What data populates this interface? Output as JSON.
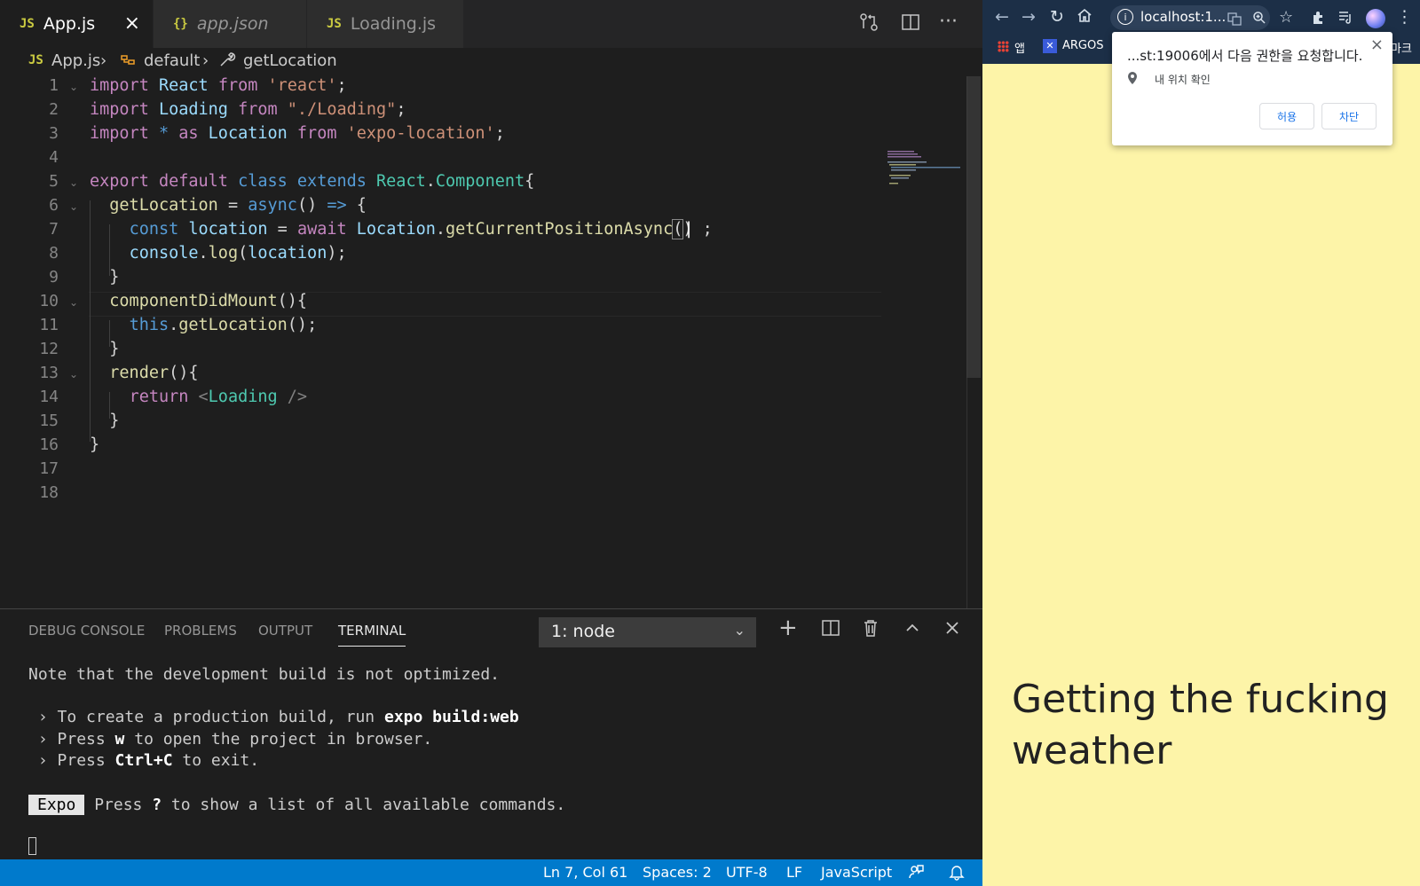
{
  "editor": {
    "tabs": [
      {
        "icon": "JS",
        "label": "App.js",
        "active": true,
        "close": "×"
      },
      {
        "icon": "{}",
        "label": "app.json",
        "active": false
      },
      {
        "icon": "JS",
        "label": "Loading.js",
        "active": false
      }
    ],
    "breadcrumb": {
      "file_icon": "JS",
      "file": "App.js",
      "sep": "›",
      "symbol1": "default",
      "symbol2": "getLocation"
    },
    "line_numbers": [
      "1",
      "2",
      "3",
      "4",
      "5",
      "6",
      "7",
      "8",
      "9",
      "10",
      "11",
      "12",
      "13",
      "14",
      "15",
      "16",
      "17",
      "18"
    ]
  },
  "panel": {
    "tabs": [
      "DEBUG CONSOLE",
      "PROBLEMS",
      "OUTPUT",
      "TERMINAL"
    ],
    "active_tab": "TERMINAL",
    "terminal_selector": "1: node",
    "terminal": {
      "line1": "Note that the development build is not optimized.",
      "arrow": "›",
      "l2a": " To create a production build, run ",
      "l2b": "expo build:web",
      "l3a": " Press ",
      "l3b": "w",
      "l3c": " to open the project in browser.",
      "l4a": " Press ",
      "l4b": "Ctrl+C",
      "l4c": " to exit.",
      "badge": "Expo",
      "l5a": " Press ",
      "l5b": "?",
      "l5c": " to show a list of all available commands."
    }
  },
  "status": {
    "position": "Ln 7, Col 61",
    "spaces": "Spaces: 2",
    "encoding": "UTF-8",
    "eol": "LF",
    "language": "JavaScript"
  },
  "browser": {
    "url": "localhost:1...",
    "bookmarks": {
      "apps": "앱",
      "argos": "ARGOS",
      "more": "마크"
    },
    "permission": {
      "title": "...st:19006에서 다음 권한을 요청합니다.",
      "item": "내 위치 확인",
      "allow": "허용",
      "block": "차단",
      "close": "×"
    },
    "page_text": "Getting the fucking weather"
  },
  "colors": {
    "statusbar": "#007acc",
    "page_bg": "#fdf4a8",
    "chrome_bar": "#1c2f47"
  }
}
